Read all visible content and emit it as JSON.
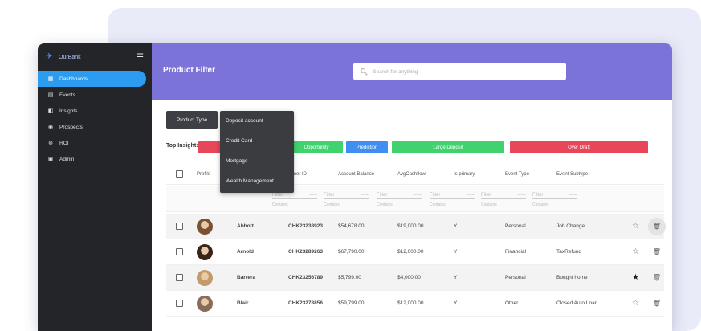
{
  "app": {
    "brand": "OurBank"
  },
  "sidebar": {
    "items": [
      {
        "label": "Dashboards",
        "icon": "dashboard-icon",
        "glyph": "▦",
        "active": true
      },
      {
        "label": "Events",
        "icon": "events-icon",
        "glyph": "▤",
        "active": false
      },
      {
        "label": "Insights",
        "icon": "insights-icon",
        "glyph": "◧",
        "active": false
      },
      {
        "label": "Prospects",
        "icon": "prospects-icon",
        "glyph": "◉",
        "active": false
      },
      {
        "label": "ROI",
        "icon": "roi-icon",
        "glyph": "⊛",
        "active": false
      },
      {
        "label": "Admin",
        "icon": "admin-icon",
        "glyph": "▣",
        "active": false
      }
    ]
  },
  "header": {
    "title": "Product Filter",
    "search_placeholder": "Search for anything"
  },
  "filter": {
    "product_type_label": "Product Type",
    "options": [
      "Deposit account",
      "Credit Card",
      "Mortgage",
      "Wealth Management"
    ]
  },
  "insights": {
    "label": "Top Insights:",
    "tags": [
      {
        "label": "",
        "color": "#e8475a"
      },
      {
        "label": "Opportunity",
        "color": "#3fd26f"
      },
      {
        "label": "Prediction",
        "color": "#3f8ef0"
      },
      {
        "label": "Large Deposit",
        "color": "#3fd26f"
      },
      {
        "label": "Over Draft",
        "color": "#e8475a"
      }
    ]
  },
  "table": {
    "columns": [
      "Profile",
      "tomer ID",
      "Account Balance",
      "AvgCashflow",
      "Is primary",
      "Event Type",
      "Event Subtype"
    ],
    "filter_placeholder": "Filter",
    "filter_sub": "Contains",
    "rows": [
      {
        "name": "Abbott",
        "id": "CHK23238923",
        "balance": "$54,678.00",
        "cashflow": "$19,000.00",
        "primary": "Y",
        "event_type": "Personal",
        "event_subtype": "Job Change",
        "starred": false,
        "avatar": "#7a5233"
      },
      {
        "name": "Arnold",
        "id": "CHK23289263",
        "balance": "$67,790.00",
        "cashflow": "$12,000.00",
        "primary": "Y",
        "event_type": "Financial",
        "event_subtype": "TaxRefund",
        "starred": false,
        "avatar": "#3a2418"
      },
      {
        "name": "Barrera",
        "id": "CHK23256789",
        "balance": "$5,799.00",
        "cashflow": "$4,000.00",
        "primary": "Y",
        "event_type": "Personal",
        "event_subtype": "Bought home",
        "starred": true,
        "avatar": "#c49a6c"
      },
      {
        "name": "Blair",
        "id": "CHK23278856",
        "balance": "$59,799.00",
        "cashflow": "$12,000.00",
        "primary": "Y",
        "event_type": "Other",
        "event_subtype": "Closed Auto Loan",
        "starred": false,
        "avatar": "#8a6a58"
      }
    ]
  }
}
